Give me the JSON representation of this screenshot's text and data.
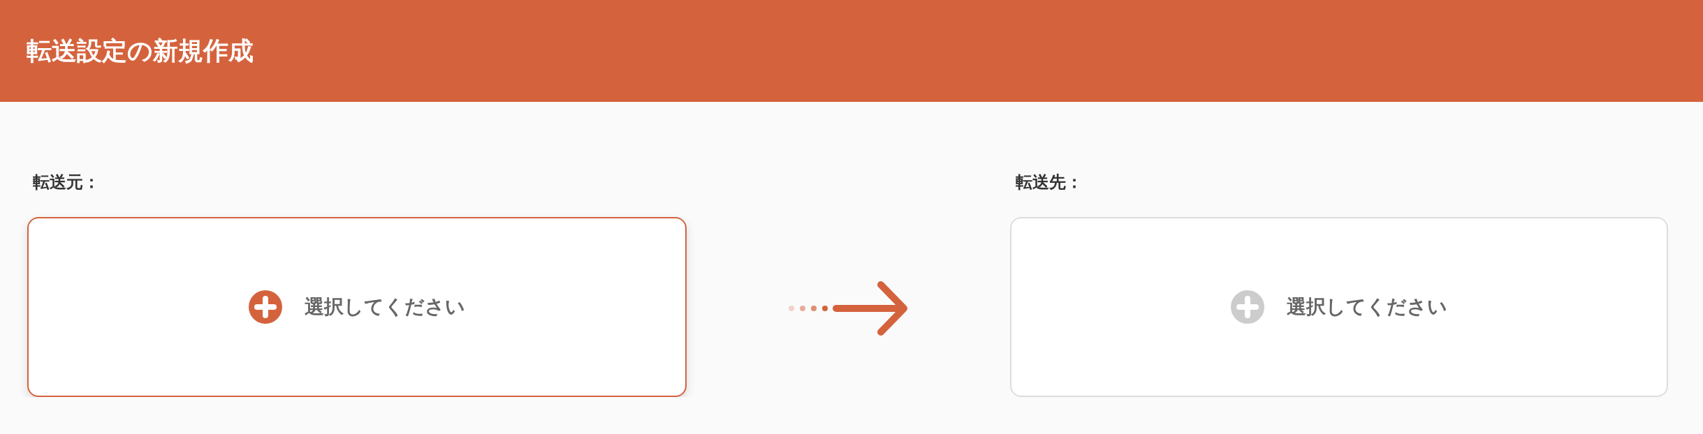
{
  "header": {
    "title": "転送設定の新規作成"
  },
  "panels": [
    {
      "label": "転送元：",
      "placeholder": "選択してください",
      "selected": true
    },
    {
      "label": "転送先：",
      "placeholder": "選択してください",
      "selected": false
    }
  ]
}
